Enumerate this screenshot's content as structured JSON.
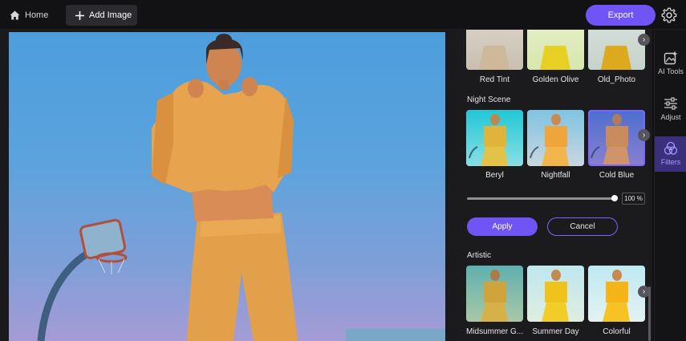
{
  "topbar": {
    "home_label": "Home",
    "add_image_label": "Add Image",
    "export_label": "Export"
  },
  "filters": {
    "top_row": [
      "Red Tint",
      "Golden Olive",
      "Old_Photo"
    ],
    "night_scene": {
      "title": "Night Scene",
      "items": [
        "Beryl",
        "Nightfall",
        "Cold Blue"
      ],
      "selected": "Cold Blue"
    },
    "intensity": "100 %",
    "intensity_value": 100,
    "apply_label": "Apply",
    "cancel_label": "Cancel",
    "artistic": {
      "title": "Artistic",
      "items": [
        "Midsummer G...",
        "Summer Day",
        "Colorful"
      ]
    }
  },
  "tools": {
    "ai_tools": "AI Tools",
    "adjust": "Adjust",
    "filters": "Filters",
    "active": "Filters"
  },
  "colors": {
    "accent": "#7154f6",
    "background": "#1b1b1e"
  }
}
